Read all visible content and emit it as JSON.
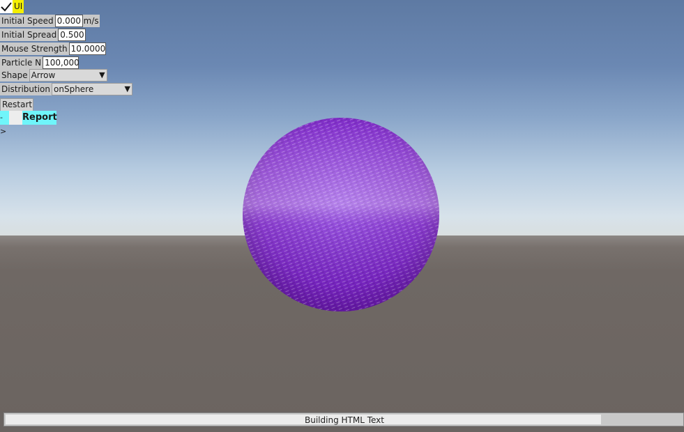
{
  "controls": {
    "ui_toggle": {
      "label": "UI",
      "checked": true
    },
    "initial_speed": {
      "label": "Initial Speed",
      "value": "0.000",
      "unit": "m/s"
    },
    "initial_spread": {
      "label": "Initial Spread",
      "value": "0.500"
    },
    "mouse_strength": {
      "label": "Mouse Strength",
      "value": "10.0000"
    },
    "particle_n": {
      "label": "Particle N",
      "value": "100,000"
    },
    "shape": {
      "label": "Shape",
      "selected": "Arrow"
    },
    "distribution": {
      "label": "Distribution",
      "selected": "onSphere"
    },
    "restart_label": "Restart",
    "report_arrow": "->",
    "report_label": "Report"
  },
  "status": {
    "progress_text": "Building HTML Text",
    "progress_fraction": 0.88
  },
  "colors": {
    "particle": "#7a22c8",
    "sky_top": "#5e7aa3",
    "ground": "#6b6460",
    "ui_highlight": "#f4ef00",
    "report_accent": "#6ff5fa"
  }
}
